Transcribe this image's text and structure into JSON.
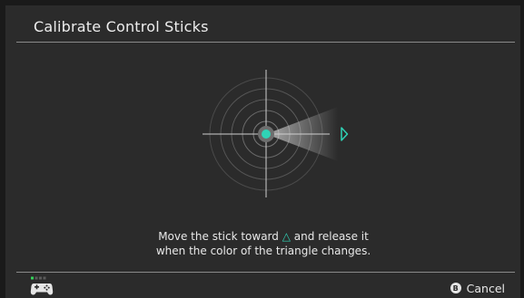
{
  "header": {
    "title": "Calibrate Control Sticks"
  },
  "instructions": {
    "line1_before": "Move the stick toward",
    "line1_after": "and release it",
    "line2": "when the color of the triangle changes."
  },
  "footer": {
    "cancel_button": {
      "key": "B",
      "label": "Cancel"
    },
    "player_indicator": {
      "active_player": 1,
      "total": 4
    }
  },
  "icons": {
    "triangle": "triangle-outline-icon",
    "controller": "controller-icon",
    "b-button": "b-button-icon"
  },
  "colors": {
    "accent": "#2fd3b6",
    "background": "#2b2b2b",
    "text": "#e8e8e8",
    "indicator_active": "#35d35a"
  }
}
